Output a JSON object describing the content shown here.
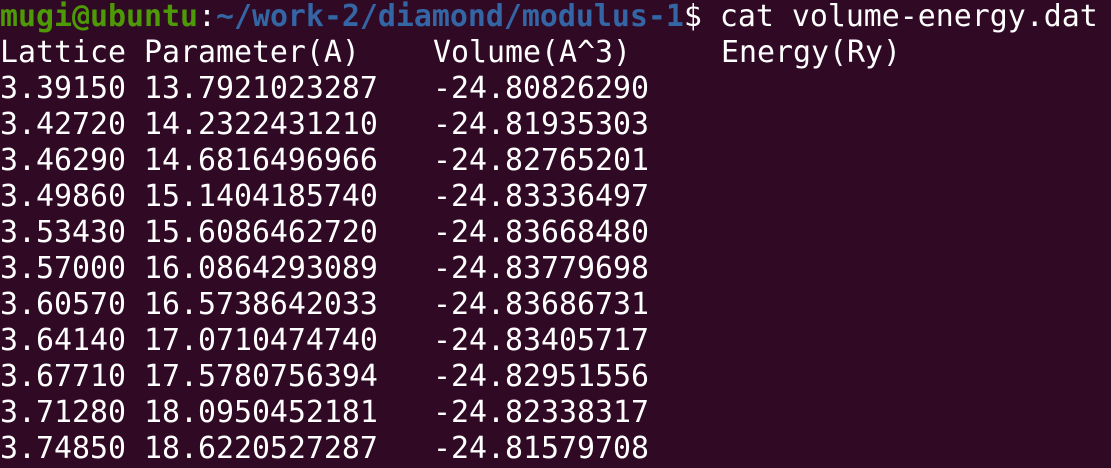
{
  "prompt": {
    "user_host": "mugi@ubuntu",
    "separator": ":",
    "path": "~/work-2/diamond/modulus-1",
    "symbol": "$ ",
    "command": "cat volume-energy.dat"
  },
  "headers": [
    "Lattice Parameter(A)",
    "Volume(A^3)",
    "Energy(Ry)"
  ],
  "rows": [
    [
      "3.39150 13.7921023287",
      "-24.80826290"
    ],
    [
      "3.42720 14.2322431210",
      "-24.81935303"
    ],
    [
      "3.46290 14.6816496966",
      "-24.82765201"
    ],
    [
      "3.49860 15.1404185740",
      "-24.83336497"
    ],
    [
      "3.53430 15.6086462720",
      "-24.83668480"
    ],
    [
      "3.57000 16.0864293089",
      "-24.83779698"
    ],
    [
      "3.60570 16.5738642033",
      "-24.83686731"
    ],
    [
      "3.64140 17.0710474740",
      "-24.83405717"
    ],
    [
      "3.67710 17.5780756394",
      "-24.82951556"
    ],
    [
      "3.71280 18.0950452181",
      "-24.82338317"
    ],
    [
      "3.74850 18.6220527287",
      "-24.81579708"
    ]
  ],
  "colors": {
    "background": "#300a24",
    "user": "#4e9a06",
    "path": "#3465a4",
    "text": "#ffffff"
  }
}
